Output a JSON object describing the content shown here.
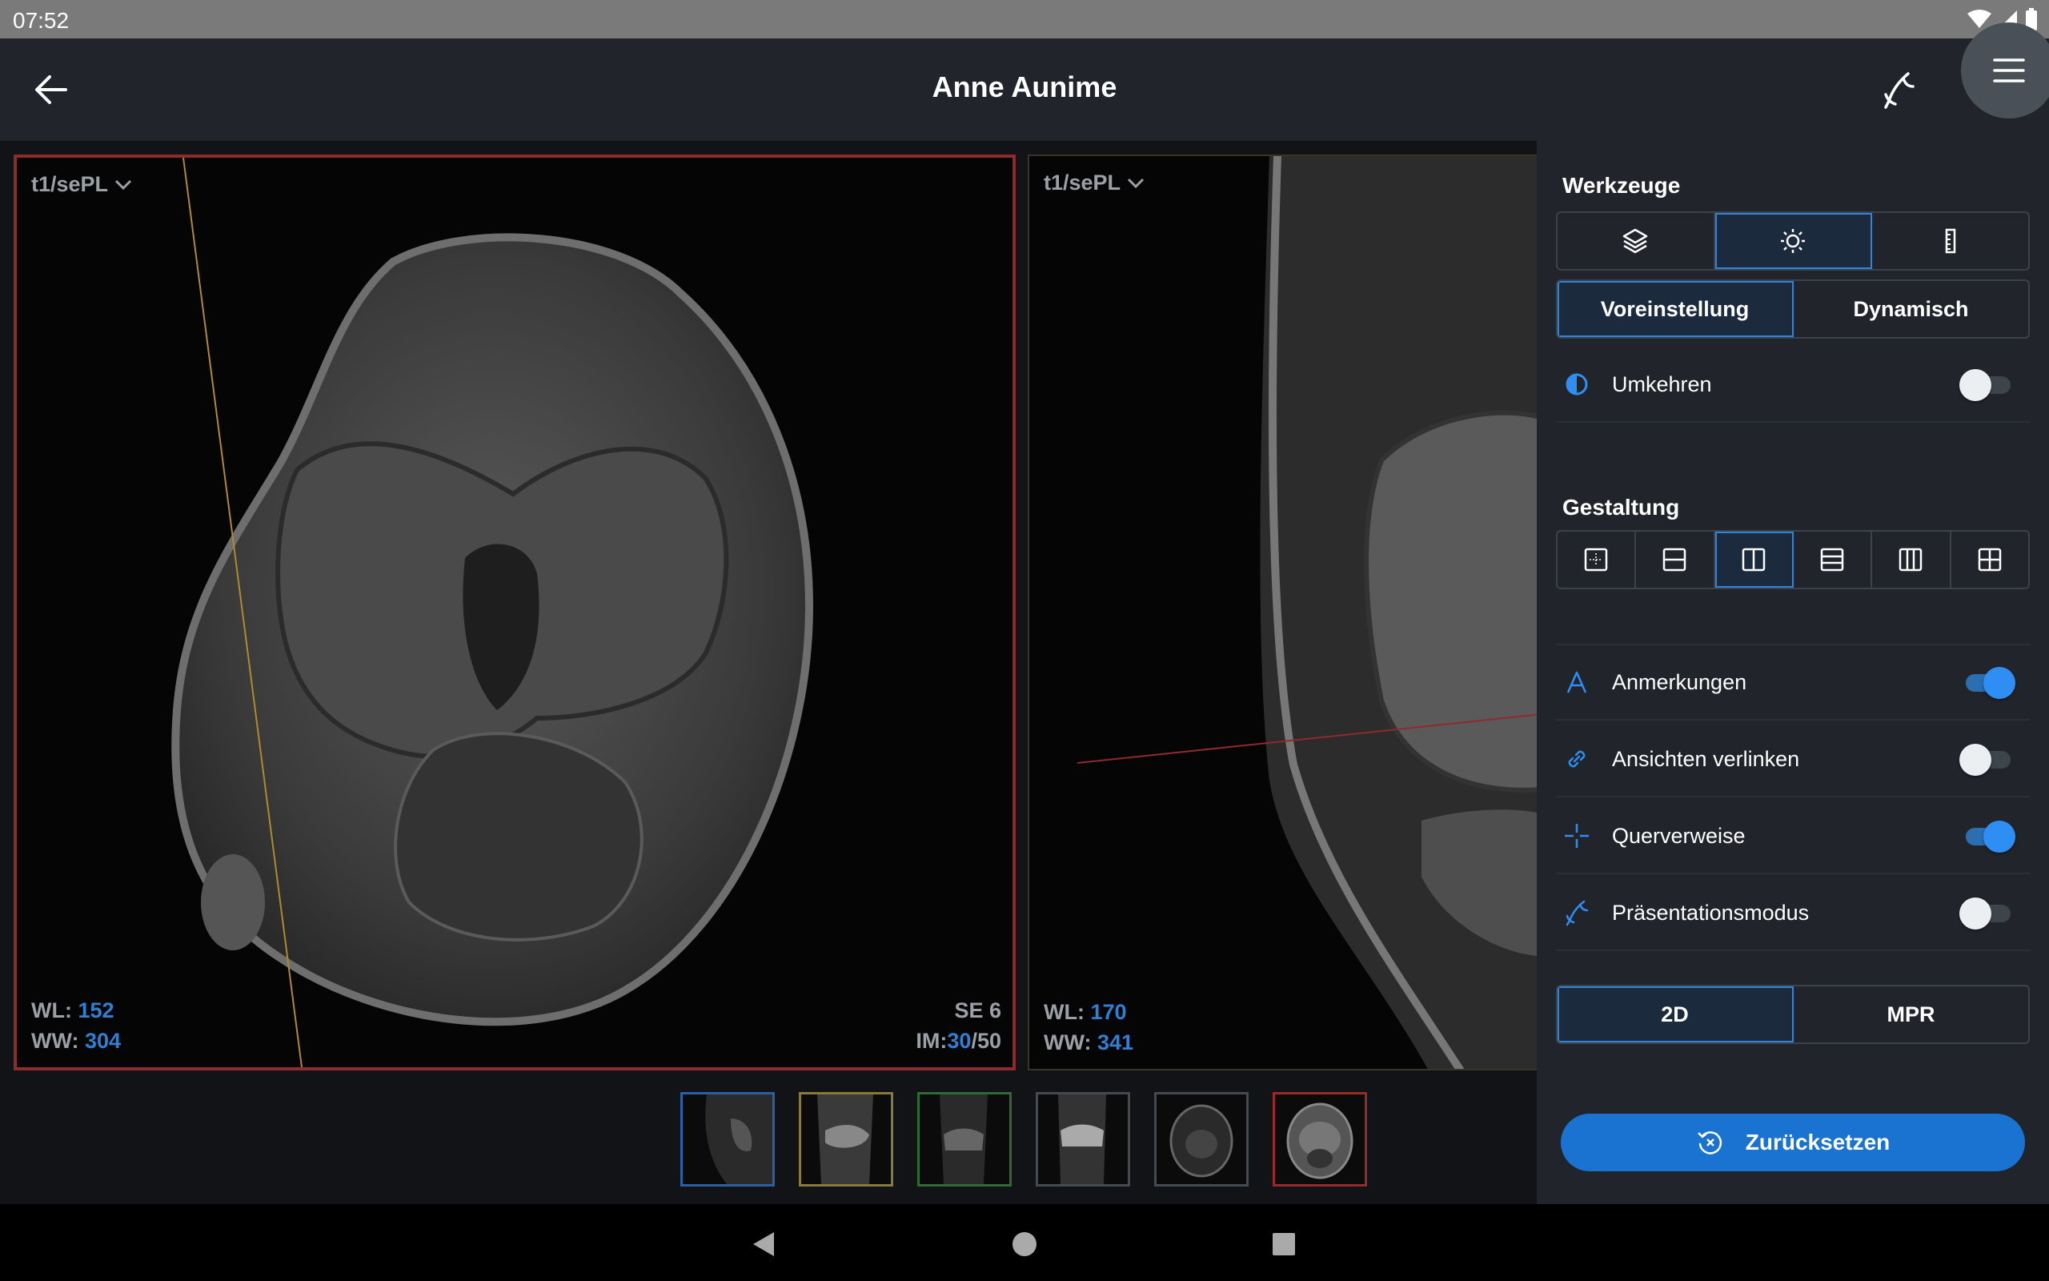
{
  "status_bar": {
    "time": "07:52"
  },
  "app_bar": {
    "title": "Anne Aunime"
  },
  "viewports": [
    {
      "series": "t1/sePL",
      "wl_label": "WL:",
      "wl": "152",
      "ww_label": "WW:",
      "ww": "304",
      "se": "SE 6",
      "im_label": "IM:",
      "im_current": "30",
      "im_total": "/50"
    },
    {
      "series": "t1/sePL",
      "wl_label": "WL:",
      "wl": "170",
      "ww_label": "WW:",
      "ww": "341"
    }
  ],
  "thumbnails": [
    {
      "border": "#2a5fa8"
    },
    {
      "border": "#8a7a3a"
    },
    {
      "border": "#2f6a34"
    },
    {
      "border": "#444a52"
    },
    {
      "border": "#444a52"
    },
    {
      "border": "#9a2a2a"
    }
  ],
  "panel": {
    "tools_title": "Werkzeuge",
    "tool_icons": [
      "layers-icon",
      "brightness-icon",
      "ruler-icon"
    ],
    "window_modes": {
      "preset": "Voreinstellung",
      "dynamic": "Dynamisch"
    },
    "invert": {
      "label": "Umkehren",
      "on": false
    },
    "layout_title": "Gestaltung",
    "layout_icons": [
      "layout-single-icon",
      "layout-2-rows-icon",
      "layout-2-cols-icon",
      "layout-3-rows-icon",
      "layout-3-cols-icon",
      "layout-grid-icon"
    ],
    "settings": [
      {
        "label": "Anmerkungen",
        "icon": "annotation-icon",
        "on": true
      },
      {
        "label": "Ansichten verlinken",
        "icon": "link-icon",
        "on": false
      },
      {
        "label": "Querverweise",
        "icon": "crosshair-icon",
        "on": true
      },
      {
        "label": "Präsentationsmodus",
        "icon": "presentation-icon",
        "on": false
      }
    ],
    "mode": {
      "twod": "2D",
      "mpr": "MPR"
    },
    "reset_label": "Zurücksetzen"
  },
  "colors": {
    "accent": "#2f8ef3",
    "active_border": "#8e2b2d",
    "panel_bg": "#21252b"
  }
}
